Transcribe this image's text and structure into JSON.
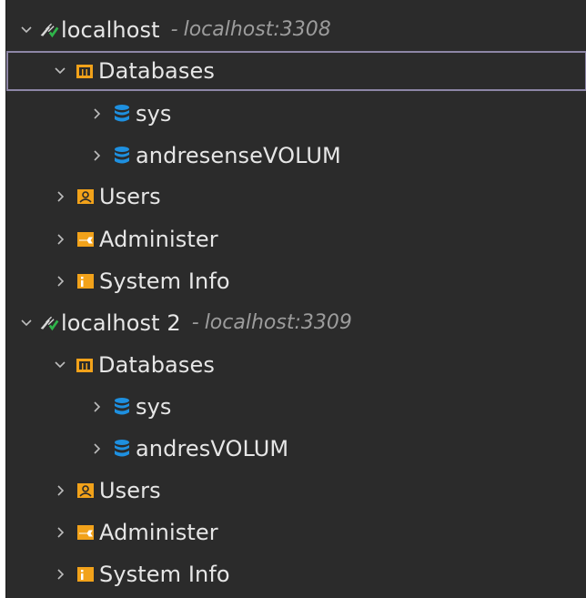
{
  "connections": [
    {
      "name": "localhost",
      "address": "localhost:3308",
      "children": {
        "databases_label": "Databases",
        "databases": [
          "sys",
          "andresenseVOLUM"
        ],
        "users_label": "Users",
        "administer_label": "Administer",
        "system_info_label": "System Info"
      }
    },
    {
      "name": "localhost 2",
      "address": "localhost:3309",
      "children": {
        "databases_label": "Databases",
        "databases": [
          "sys",
          "andresVOLUM"
        ],
        "users_label": "Users",
        "administer_label": "Administer",
        "system_info_label": "System Info"
      }
    }
  ],
  "separator": "-",
  "colors": {
    "panel_bg": "#2b2b2b",
    "text": "#e6e6e6",
    "muted": "#9c9c9c",
    "db_blue": "#1e90e0",
    "folder_orange": "#f2a21a",
    "selection_border": "#8d86a6"
  },
  "icons": {
    "connection": "connection-plug-icon",
    "databases": "databases-folder-icon",
    "database": "database-cylinder-icon",
    "users": "users-folder-icon",
    "administer": "administer-wrench-icon",
    "system_info": "system-info-icon"
  }
}
